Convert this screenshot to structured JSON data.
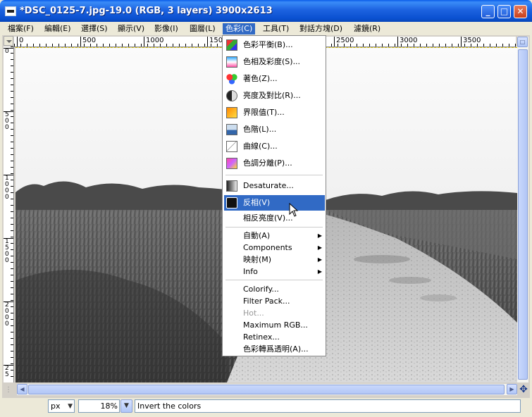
{
  "window": {
    "title": "*DSC_0125-7.jpg-19.0 (RGB, 3 layers) 3900x2613",
    "buttons": {
      "minimize": "_",
      "maximize": "□",
      "close": "✕"
    }
  },
  "menubar": [
    {
      "label": "檔案(F)"
    },
    {
      "label": "編輯(E)"
    },
    {
      "label": "選擇(S)"
    },
    {
      "label": "顯示(V)"
    },
    {
      "label": "影像(I)"
    },
    {
      "label": "圖層(L)"
    },
    {
      "label": "色彩(C)",
      "active": true
    },
    {
      "label": "工具(T)"
    },
    {
      "label": "對話方塊(D)"
    },
    {
      "label": "濾鏡(R)"
    }
  ],
  "ruler": {
    "h_ticks": [
      "0",
      "500",
      "1000",
      "150",
      "2500",
      "3000",
      "3500"
    ],
    "v_ticks": [
      "0",
      "500",
      "1000",
      "1500",
      "2000",
      "25"
    ]
  },
  "color_menu": {
    "items": [
      {
        "label": "色彩平衡(B)...",
        "icon": "color-balance-icon"
      },
      {
        "label": "色相及彩度(S)...",
        "icon": "hue-saturation-icon"
      },
      {
        "label": "著色(Z)...",
        "icon": "colorize-icon"
      },
      {
        "label": "亮度及對比(R)...",
        "icon": "brightness-contrast-icon"
      },
      {
        "label": "界限值(T)...",
        "icon": "threshold-icon"
      },
      {
        "label": "色階(L)...",
        "icon": "levels-icon"
      },
      {
        "label": "曲線(C)...",
        "icon": "curves-icon"
      },
      {
        "label": "色調分離(P)...",
        "icon": "posterize-icon"
      },
      {
        "label": "Desaturate...",
        "icon": "desaturate-icon"
      },
      {
        "label": "反相(V)",
        "icon": "invert-icon",
        "highlighted": true
      },
      {
        "label": "相反亮度(V)..."
      },
      {
        "label": "自動(A)",
        "submenu": true
      },
      {
        "label": "Components",
        "submenu": true
      },
      {
        "label": "映射(M)",
        "submenu": true
      },
      {
        "label": "Info",
        "submenu": true
      },
      {
        "label": "Colorify..."
      },
      {
        "label": "Filter Pack..."
      },
      {
        "label": "Hot...",
        "disabled": true
      },
      {
        "label": "Maximum RGB..."
      },
      {
        "label": "Retinex..."
      },
      {
        "label": "色彩轉爲透明(A)..."
      }
    ]
  },
  "statusbar": {
    "unit": "px",
    "zoom": "18%",
    "message": "Invert the colors"
  },
  "colors": {
    "titlebar": "#0a5ce8",
    "highlight": "#316ac5",
    "chrome": "#ece9d8"
  }
}
